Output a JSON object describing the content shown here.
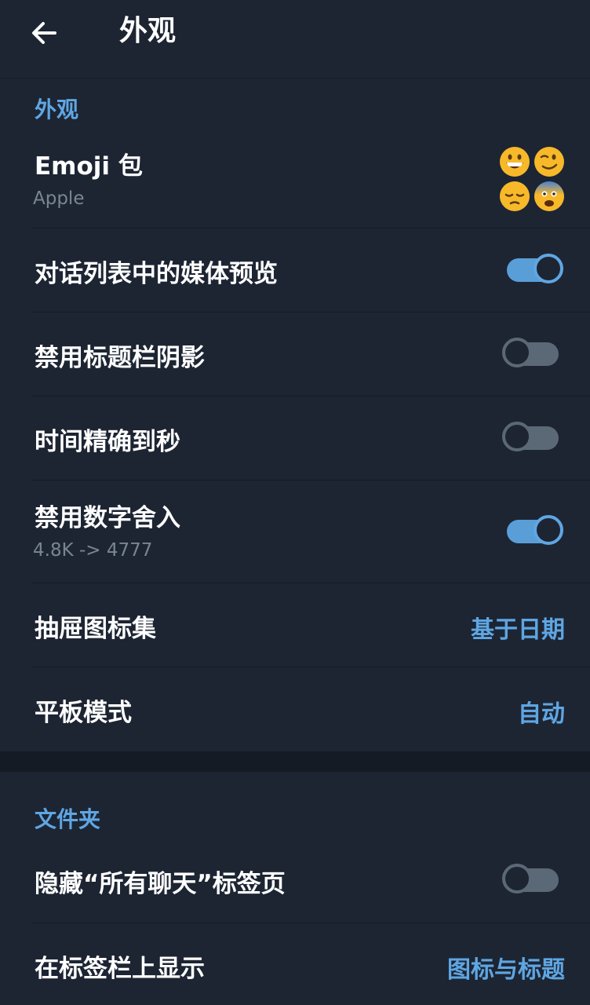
{
  "header": {
    "title": "外观"
  },
  "sections": {
    "appearance_label": "外观",
    "folders_label": "文件夹"
  },
  "rows": {
    "emoji_pack": {
      "title": "Emoji 包",
      "subtitle": "Apple"
    },
    "media_preview": {
      "title": "对话列表中的媒体预览",
      "enabled": true
    },
    "disable_shadow": {
      "title": "禁用标题栏阴影",
      "enabled": false
    },
    "precise_time": {
      "title": "时间精确到秒",
      "enabled": false
    },
    "disable_rounding": {
      "title": "禁用数字舍入",
      "subtitle": "4.8K -> 4777",
      "enabled": true
    },
    "drawer_icons": {
      "title": "抽屉图标集",
      "value": "基于日期"
    },
    "tablet_mode": {
      "title": "平板模式",
      "value": "自动"
    },
    "hide_all_chats": {
      "title": "隐藏“所有聊天”标签页",
      "enabled": false
    },
    "tab_display": {
      "title": "在标签栏上显示",
      "value": "图标与标题"
    }
  },
  "emoji_preview": [
    "grinning-face-emoji",
    "winking-face-emoji",
    "pensive-face-emoji",
    "anxious-face-emoji"
  ],
  "colors": {
    "background": "#1d2533",
    "accent": "#5fa6e3",
    "toggle_off": "#5b6977",
    "secondary_text": "#7a8593"
  }
}
